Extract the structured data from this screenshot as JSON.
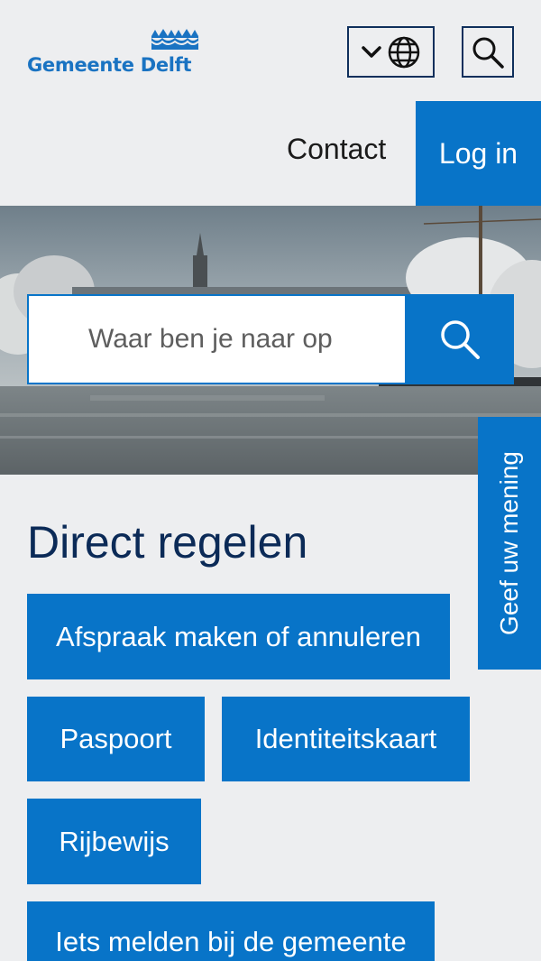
{
  "header": {
    "logo_text": "Gemeente Delft",
    "language_button_label": "Taal kiezen",
    "search_button_label": "Zoeken"
  },
  "nav": {
    "contact": "Contact",
    "login": "Log in"
  },
  "search": {
    "placeholder": "Waar ben je naar op"
  },
  "feedback": {
    "label": "Geef uw mening"
  },
  "direct": {
    "title": "Direct regelen",
    "items": [
      {
        "label": "Afspraak maken of annuleren"
      },
      {
        "label": "Paspoort"
      },
      {
        "label": "Identiteitskaart"
      },
      {
        "label": "Rijbewijs"
      },
      {
        "label": "Iets melden bij de gemeente"
      }
    ]
  },
  "colors": {
    "primary": "#0874c8",
    "navy": "#0b2a57",
    "background": "#edeef0",
    "logo_blue": "#1a73c2"
  },
  "icons": [
    "crown-logo-icon",
    "chevron-down-icon",
    "globe-icon",
    "search-icon"
  ]
}
